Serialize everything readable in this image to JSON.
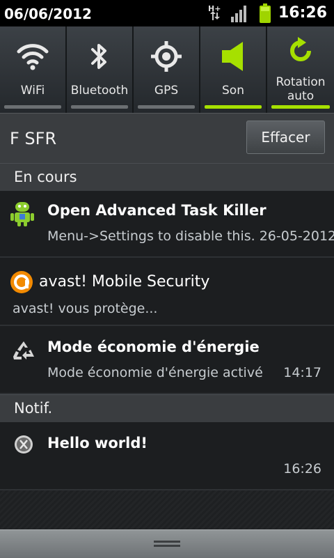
{
  "status_bar": {
    "date": "06/06/2012",
    "time": "16:26",
    "network": "H+",
    "icons": [
      "network-h-plus-icon",
      "signal-bars-icon",
      "battery-icon"
    ]
  },
  "toggles": [
    {
      "label": "WiFi",
      "icon": "wifi-icon",
      "on": false
    },
    {
      "label": "Bluetooth",
      "icon": "bluetooth-icon",
      "on": false
    },
    {
      "label": "GPS",
      "icon": "gps-icon",
      "on": false
    },
    {
      "label": "Son",
      "icon": "speaker-icon",
      "on": true
    },
    {
      "label_line1": "Rotation",
      "label_line2": "auto",
      "icon": "rotation-icon",
      "on": true
    }
  ],
  "carrier": {
    "name": "F SFR",
    "clear_label": "Effacer"
  },
  "sections": {
    "ongoing": "En cours",
    "notif": "Notif."
  },
  "notifications": [
    {
      "icon": "android-task-killer-icon",
      "title": "Open Advanced Task Killer",
      "text": "Menu->Settings to disable this. 26-05-2012"
    },
    {
      "icon": "avast-icon",
      "title": "avast! Mobile Security",
      "text": "avast! vous protège..."
    },
    {
      "icon": "recycle-icon",
      "title": "Mode économie d'énergie",
      "text": "Mode économie d'énergie activé",
      "time": "14:17"
    },
    {
      "icon": "x-placeholder-icon",
      "title": "Hello world!",
      "time": "16:26"
    }
  ],
  "colors": {
    "accent_on": "#a6e000",
    "status_bar_bg": "#000000",
    "panel_bg": "#1c1e20",
    "header_bg": "#3a3d40"
  }
}
